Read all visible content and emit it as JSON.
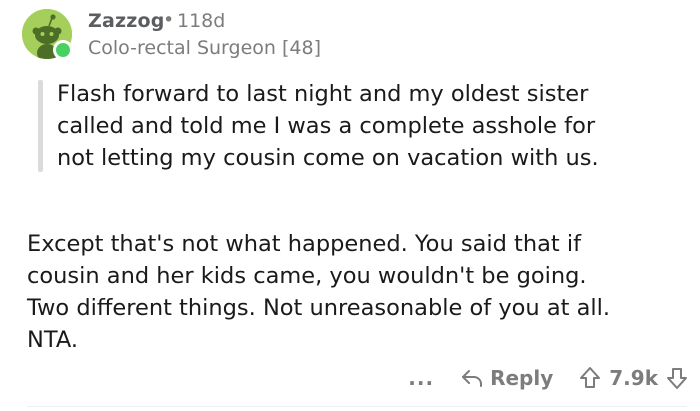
{
  "comment": {
    "username": "Zazzog",
    "separator": "•",
    "age": "118d",
    "flair": "Colo-rectal Surgeon [48]",
    "quote": "Flash forward to last night and my oldest sister\ncalled and told me I was a complete asshole for\nnot letting my cousin come on vacation with us.",
    "body": "Except that's not what happened. You said that if\ncousin and her kids came, you wouldn't be going.\nTwo different things. Not unreasonable of you at all.\nNTA.",
    "actions": {
      "more_label": "...",
      "reply_label": "Reply",
      "score": "7.9k"
    }
  },
  "colors": {
    "avatar_bg": "#a5cf5b",
    "online": "#46d160",
    "meta_text": "#7c7c7c",
    "body_text": "#1a1a1b"
  },
  "icons": {
    "avatar": "snoo-avatar-icon",
    "reply": "reply-arrow-icon",
    "upvote": "upvote-arrow-icon",
    "downvote": "downvote-arrow-icon"
  }
}
